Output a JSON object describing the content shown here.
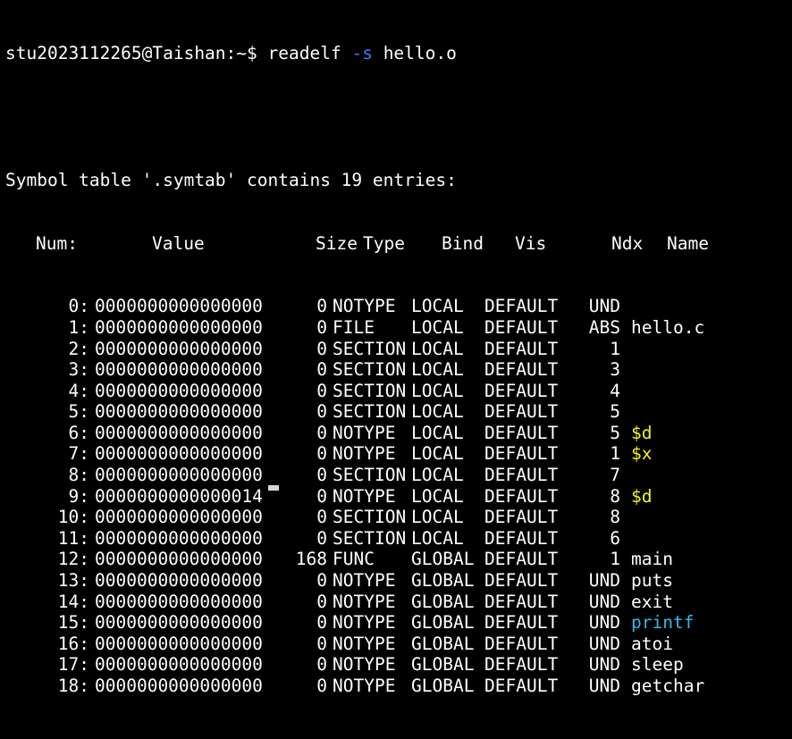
{
  "prompt": {
    "user_host": "stu2023112265@Taishan:~$",
    "cmd": "readelf",
    "flag": "-s",
    "arg": "hello.o"
  },
  "title_line": "Symbol table '.symtab' contains 19 entries:",
  "headers": {
    "num": "Num:",
    "value": "Value",
    "size": "Size",
    "type": "Type",
    "bind": "Bind",
    "vis": "Vis",
    "ndx": "Ndx",
    "name": "Name"
  },
  "rows": [
    {
      "num": "0:",
      "value": "0000000000000000",
      "size": "0",
      "type": "NOTYPE",
      "bind": "LOCAL",
      "vis": "DEFAULT",
      "ndx": "UND",
      "name": ""
    },
    {
      "num": "1:",
      "value": "0000000000000000",
      "size": "0",
      "type": "FILE",
      "bind": "LOCAL",
      "vis": "DEFAULT",
      "ndx": "ABS",
      "name": "hello.c"
    },
    {
      "num": "2:",
      "value": "0000000000000000",
      "size": "0",
      "type": "SECTION",
      "bind": "LOCAL",
      "vis": "DEFAULT",
      "ndx": "1",
      "name": ""
    },
    {
      "num": "3:",
      "value": "0000000000000000",
      "size": "0",
      "type": "SECTION",
      "bind": "LOCAL",
      "vis": "DEFAULT",
      "ndx": "3",
      "name": ""
    },
    {
      "num": "4:",
      "value": "0000000000000000",
      "size": "0",
      "type": "SECTION",
      "bind": "LOCAL",
      "vis": "DEFAULT",
      "ndx": "4",
      "name": ""
    },
    {
      "num": "5:",
      "value": "0000000000000000",
      "size": "0",
      "type": "SECTION",
      "bind": "LOCAL",
      "vis": "DEFAULT",
      "ndx": "5",
      "name": ""
    },
    {
      "num": "6:",
      "value": "0000000000000000",
      "size": "0",
      "type": "NOTYPE",
      "bind": "LOCAL",
      "vis": "DEFAULT",
      "ndx": "5",
      "name": "$d"
    },
    {
      "num": "7:",
      "value": "0000000000000000",
      "size": "0",
      "type": "NOTYPE",
      "bind": "LOCAL",
      "vis": "DEFAULT",
      "ndx": "1",
      "name": "$x"
    },
    {
      "num": "8:",
      "value": "0000000000000000",
      "size": "0",
      "type": "SECTION",
      "bind": "LOCAL",
      "vis": "DEFAULT",
      "ndx": "7",
      "name": ""
    },
    {
      "num": "9:",
      "value": "0000000000000014",
      "size": "0",
      "type": "NOTYPE",
      "bind": "LOCAL",
      "vis": "DEFAULT",
      "ndx": "8",
      "name": "$d"
    },
    {
      "num": "10:",
      "value": "0000000000000000",
      "size": "0",
      "type": "SECTION",
      "bind": "LOCAL",
      "vis": "DEFAULT",
      "ndx": "8",
      "name": ""
    },
    {
      "num": "11:",
      "value": "0000000000000000",
      "size": "0",
      "type": "SECTION",
      "bind": "LOCAL",
      "vis": "DEFAULT",
      "ndx": "6",
      "name": ""
    },
    {
      "num": "12:",
      "value": "0000000000000000",
      "size": "168",
      "type": "FUNC",
      "bind": "GLOBAL",
      "vis": "DEFAULT",
      "ndx": "1",
      "name": "main"
    },
    {
      "num": "13:",
      "value": "0000000000000000",
      "size": "0",
      "type": "NOTYPE",
      "bind": "GLOBAL",
      "vis": "DEFAULT",
      "ndx": "UND",
      "name": "puts"
    },
    {
      "num": "14:",
      "value": "0000000000000000",
      "size": "0",
      "type": "NOTYPE",
      "bind": "GLOBAL",
      "vis": "DEFAULT",
      "ndx": "UND",
      "name": "exit"
    },
    {
      "num": "15:",
      "value": "0000000000000000",
      "size": "0",
      "type": "NOTYPE",
      "bind": "GLOBAL",
      "vis": "DEFAULT",
      "ndx": "UND",
      "name": "printf"
    },
    {
      "num": "16:",
      "value": "0000000000000000",
      "size": "0",
      "type": "NOTYPE",
      "bind": "GLOBAL",
      "vis": "DEFAULT",
      "ndx": "UND",
      "name": "atoi"
    },
    {
      "num": "17:",
      "value": "0000000000000000",
      "size": "0",
      "type": "NOTYPE",
      "bind": "GLOBAL",
      "vis": "DEFAULT",
      "ndx": "UND",
      "name": "sleep"
    },
    {
      "num": "18:",
      "value": "0000000000000000",
      "size": "0",
      "type": "NOTYPE",
      "bind": "GLOBAL",
      "vis": "DEFAULT",
      "ndx": "UND",
      "name": "getchar"
    }
  ],
  "colors": {
    "background": "#000000",
    "text": "#ffffff",
    "flag": "#3b78ff",
    "highlight_yellow": "#f3f31a",
    "highlight_cyan": "#3ab7e6",
    "cursor": "#d8d8d8"
  },
  "name_colors": {
    "6": "highlight_yellow",
    "7": "highlight_yellow",
    "9": "highlight_yellow",
    "15": "highlight_cyan"
  }
}
